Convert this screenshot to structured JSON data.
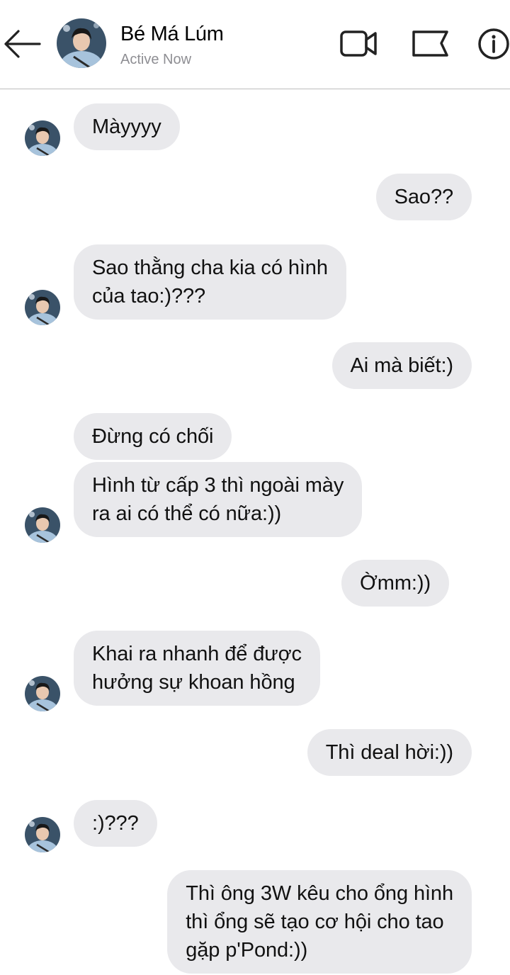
{
  "header": {
    "contact_name": "Bé Má Lúm",
    "status": "Active Now",
    "icons": [
      "back-arrow-icon",
      "video-call-icon",
      "flag-icon",
      "info-icon"
    ]
  },
  "colors": {
    "bubble": "#e9e9ec",
    "text": "#111111",
    "status": "#8e8e93",
    "divider": "#bdbdbd"
  },
  "messages": [
    {
      "side": "received",
      "text": "Màyyyy",
      "avatar": true
    },
    {
      "side": "sent",
      "text": "Sao??"
    },
    {
      "side": "received",
      "text": "Sao thằng cha kia có hình\ncủa tao:)???",
      "avatar": true
    },
    {
      "side": "sent",
      "text": "Ai mà biết:)"
    },
    {
      "side": "received",
      "text": "Đừng có chối",
      "avatar": false
    },
    {
      "side": "received",
      "text": "Hình từ cấp 3 thì ngoài mày\nra ai có thể có nữa:))",
      "avatar": true
    },
    {
      "side": "sent",
      "text": "Ờmm:))"
    },
    {
      "side": "received",
      "text": "Khai ra nhanh để được\nhưởng sự khoan hồng",
      "avatar": true
    },
    {
      "side": "sent",
      "text": "Thì deal hời:))"
    },
    {
      "side": "received",
      "text": ":)???",
      "avatar": true
    },
    {
      "side": "sent",
      "text": "Thì ông 3W kêu cho ổng hình\nthì ổng sẽ tạo cơ hội cho tao\ngặp p'Pond:))"
    }
  ]
}
